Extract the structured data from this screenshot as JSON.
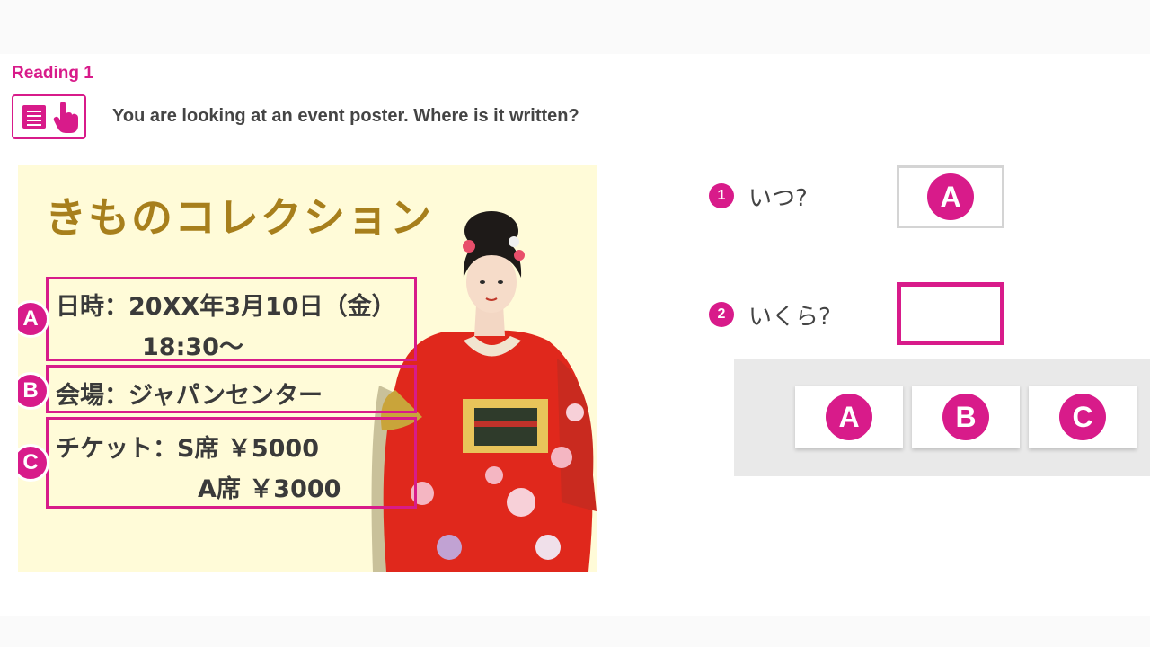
{
  "header": {
    "section_label": "Reading 1",
    "task_icon": "document-with-pointer-icon",
    "instruction": "You are looking at an event poster. Where is it written?"
  },
  "poster": {
    "title": "きものコレクション",
    "figure": "kimono-woman-illustration",
    "sections": [
      {
        "marker": "A",
        "lines": [
          "日時：20XX年3月10日（金）",
          "18:30〜"
        ]
      },
      {
        "marker": "B",
        "lines": [
          "会場：ジャパンセンター"
        ]
      },
      {
        "marker": "C",
        "lines": [
          "チケット：S席 ￥5000",
          "A席 ￥3000"
        ]
      }
    ]
  },
  "questions": [
    {
      "number": "1",
      "text": "いつ?",
      "answer": "A",
      "state": "answered"
    },
    {
      "number": "2",
      "text": "いくら?",
      "answer": "",
      "state": "active"
    }
  ],
  "choices": [
    "A",
    "B",
    "C"
  ],
  "colors": {
    "accent": "#d81b8a",
    "poster_bg": "#fffbd8",
    "title_gold": "#a77f1c",
    "tray": "#e9e9e9"
  }
}
